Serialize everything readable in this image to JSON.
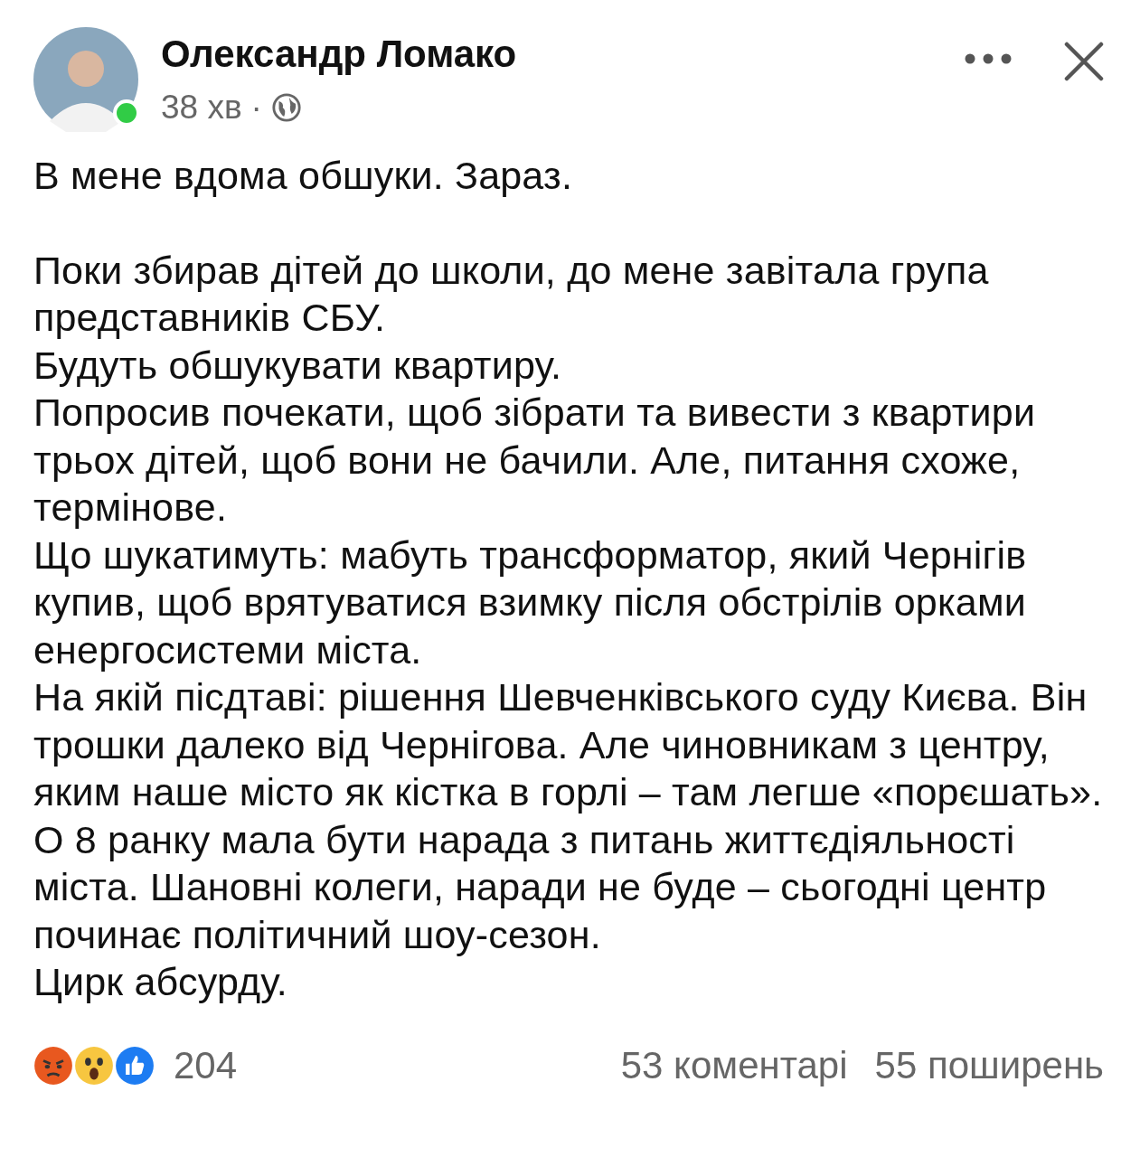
{
  "post": {
    "author": "Олександр Ломако",
    "online": true,
    "time": "38 хв",
    "separator": "·",
    "paragraphs": [
      [
        "В мене вдома обшуки. Зараз."
      ],
      [
        "Поки збирав дітей до школи, до мене завітала група представників СБУ.",
        "Будуть обшукувати квартиру.",
        "Попросив почекати, щоб зібрати та вивести з квартири трьох дітей, щоб вони не бачили. Але, питання схоже, термінове.",
        "Що шукатимуть: мабуть трансформатор, який Чернігів купив, щоб врятуватися взимку після обстрілів орками енергосистеми міста.",
        "На якій пісдтаві: рішення Шевченківського суду Києва. Він трошки далеко від Чернігова. Але чиновникам з центру, яким наше місто як кістка в горлі – там легше «порєшать».",
        "О 8 ранку мала бути нарада з питань життєдіяльності міста. Шановні колеги, наради не буде – сьогодні центр починає політичний шоу-сезон.",
        "Цирк абсурду."
      ]
    ]
  },
  "footer": {
    "reactions": [
      {
        "kind": "angry"
      },
      {
        "kind": "wow"
      },
      {
        "kind": "like"
      }
    ],
    "reaction_count": "204",
    "comments": "53 коментарі",
    "shares": "55 поширень"
  }
}
